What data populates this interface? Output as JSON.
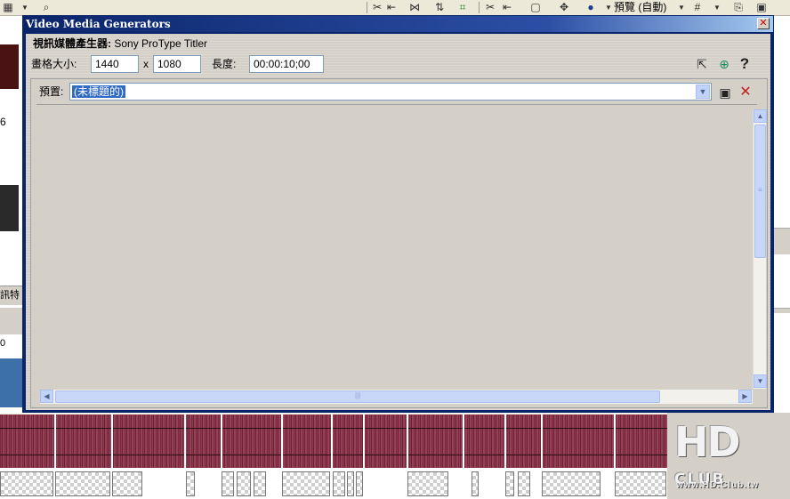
{
  "app": {
    "toolbar": {
      "preview_label": "預覽 (自動)"
    },
    "side_fragments": {
      "left_text_1": "6",
      "left_text_2": "訊特",
      "left_text_3": "0"
    }
  },
  "dialog": {
    "title": "Video Media Generators",
    "close_glyph": "✕",
    "generator": {
      "label": "視訊媒體產生器:",
      "value": "Sony ProType Titler"
    },
    "frame_size": {
      "label": "畫格大小:",
      "width": "1440",
      "separator": "x",
      "height": "1080"
    },
    "length": {
      "label": "長度:",
      "value": "00:00:10;00"
    },
    "preset": {
      "label": "預置:",
      "value": "(未標題的)"
    }
  },
  "logo": {
    "main": "HD",
    "sub": "CLUB",
    "url": "www.HD.Club.tw"
  },
  "colors": {
    "title_bar": "#0a246a",
    "audio_wave": "#8f3a4d",
    "selection": "#316ac5"
  }
}
